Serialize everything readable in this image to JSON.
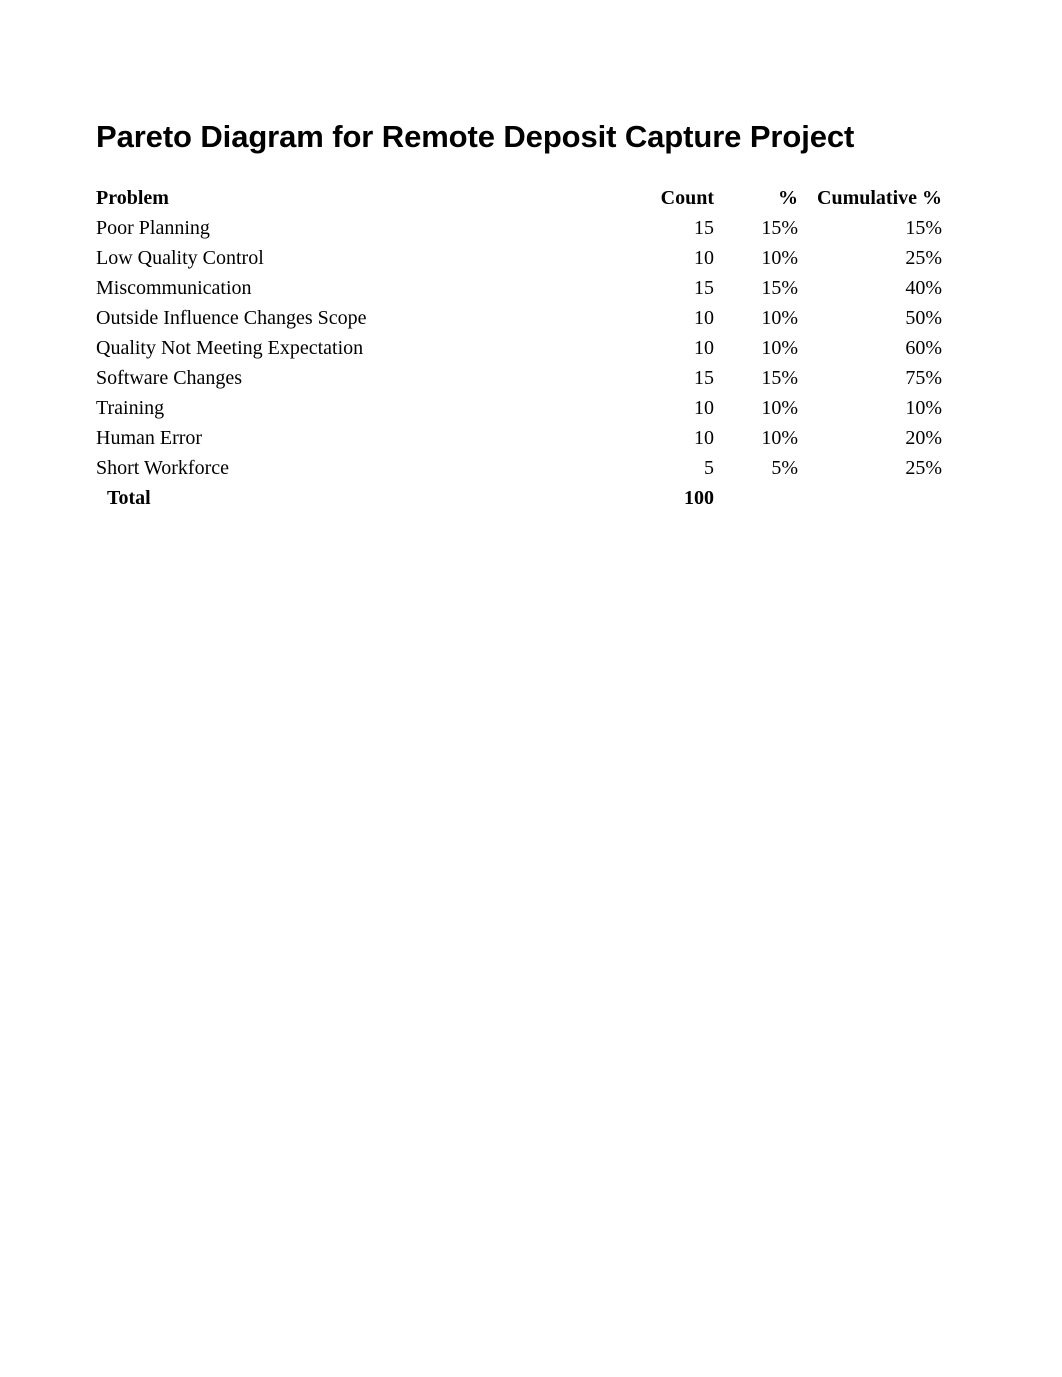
{
  "document": {
    "title": "Pareto Diagram for Remote Deposit Capture Project",
    "background_color": "#ffffff",
    "text_color": "#000000"
  },
  "table": {
    "headers": {
      "problem": "Problem",
      "count": "Count",
      "percent": "%",
      "cumulative_percent": "Cumulative %"
    },
    "rows": [
      {
        "problem": "Poor Planning",
        "count": "15",
        "percent": "15%",
        "cumulative": "15%"
      },
      {
        "problem": "Low Quality Control",
        "count": "10",
        "percent": "10%",
        "cumulative": "25%"
      },
      {
        "problem": "Miscommunication",
        "count": "15",
        "percent": "15%",
        "cumulative": "40%"
      },
      {
        "problem": "Outside Influence Changes Scope",
        "count": "10",
        "percent": "10%",
        "cumulative": "50%"
      },
      {
        "problem": "Quality Not Meeting Expectation",
        "count": "10",
        "percent": "10%",
        "cumulative": "60%"
      },
      {
        "problem": "Software Changes",
        "count": "15",
        "percent": "15%",
        "cumulative": "75%"
      },
      {
        "problem": "Training",
        "count": "10",
        "percent": "10%",
        "cumulative": "10%"
      },
      {
        "problem": "Human Error",
        "count": "10",
        "percent": "10%",
        "cumulative": "20%"
      },
      {
        "problem": "Short Workforce",
        "count": "5",
        "percent": "5%",
        "cumulative": "25%"
      }
    ],
    "total": {
      "label": "Total",
      "count": "100",
      "percent": "",
      "cumulative": ""
    }
  },
  "chart_data": {
    "type": "table",
    "title": "Pareto Diagram for Remote Deposit Capture Project",
    "xlabel": "Problem",
    "ylabel": "Count",
    "categories": [
      "Poor Planning",
      "Low Quality Control",
      "Miscommunication",
      "Outside Influence Changes Scope",
      "Quality Not Meeting Expectation",
      "Software Changes",
      "Training",
      "Human Error",
      "Short Workforce"
    ],
    "series": [
      {
        "name": "Count",
        "values": [
          15,
          10,
          15,
          10,
          10,
          15,
          10,
          10,
          5
        ]
      },
      {
        "name": "%",
        "values": [
          15,
          10,
          15,
          10,
          10,
          15,
          10,
          10,
          5
        ]
      },
      {
        "name": "Cumulative %",
        "values": [
          15,
          25,
          40,
          50,
          60,
          75,
          10,
          20,
          25
        ]
      }
    ],
    "total_count": 100,
    "grid": false,
    "legend": "none"
  }
}
